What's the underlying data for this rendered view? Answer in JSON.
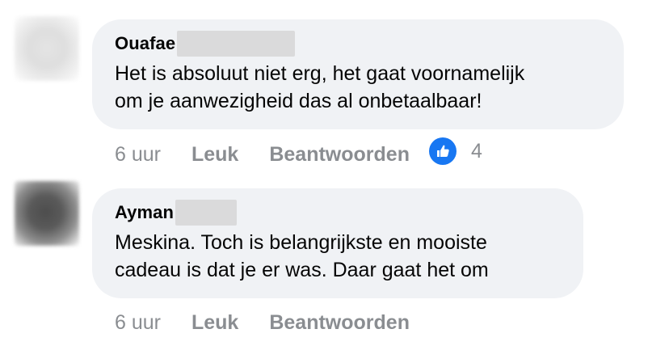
{
  "comments": [
    {
      "author": "Ouafae",
      "text_lines": [
        "Het is absoluut niet erg, het gaat voornamelijk",
        "om je aanwezigheid das al onbetaalbaar!"
      ],
      "time": "6 uur",
      "like_label": "Leuk",
      "reply_label": "Beantwoorden",
      "reaction_icon": "like-icon",
      "reaction_count": "4"
    },
    {
      "author": "Ayman",
      "text_lines": [
        "Meskina. Toch is belangrijkste en mooiste",
        "cadeau is dat je er was. Daar gaat het om"
      ],
      "time": "6 uur",
      "like_label": "Leuk",
      "reply_label": "Beantwoorden"
    }
  ],
  "colors": {
    "bubble_background": "#f0f2f5",
    "secondary_text": "#8a8d91",
    "primary_text": "#050505",
    "like_blue": "#1877f2"
  }
}
